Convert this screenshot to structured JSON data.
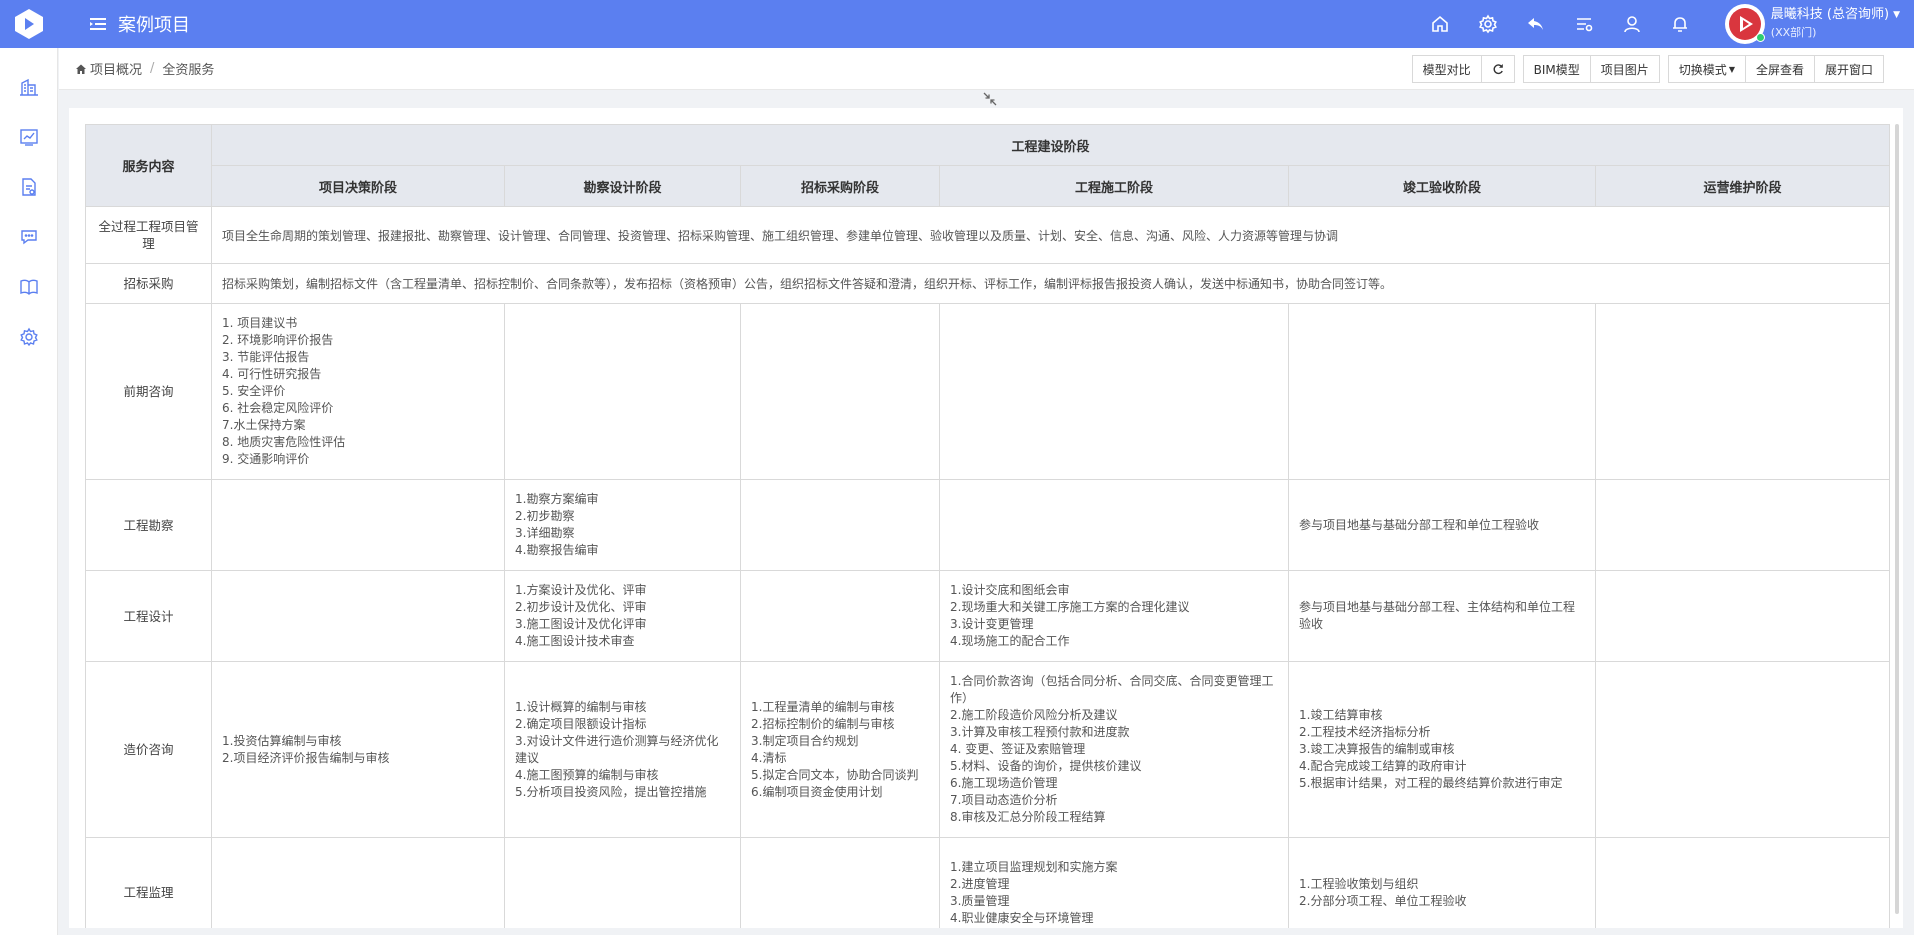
{
  "app": {
    "title": "案例项目"
  },
  "user": {
    "name": "晨曦科技 (总咨询师)",
    "dept": "(XX部门)"
  },
  "topbar_icons": [
    "home-icon",
    "settings-icon",
    "back-icon",
    "list-icon",
    "user-icon",
    "bell-icon"
  ],
  "sidebar_icons": [
    "building-icon",
    "chart-icon",
    "document-icon",
    "chat-icon",
    "book-icon",
    "gear-icon"
  ],
  "breadcrumb": {
    "home": "项目概况",
    "current": "全资服务"
  },
  "toolbar": {
    "compare": "模型对比",
    "bim": "BIM模型",
    "images": "项目图片",
    "switch_mode": "切换模式",
    "fullscreen": "全屏查看",
    "expand_window": "展开窗口"
  },
  "table": {
    "corner_header": "服务内容",
    "group_header": "工程建设阶段",
    "stages": [
      "项目决策阶段",
      "勘察设计阶段",
      "招标采购阶段",
      "工程施工阶段",
      "竣工验收阶段",
      "运营维护阶段"
    ],
    "rows": [
      {
        "label": "全过程工程项目管理",
        "span_text": "项目全生命周期的策划管理、报建报批、勘察管理、设计管理、合同管理、投资管理、招标采购管理、施工组织管理、参建单位管理、验收管理以及质量、计划、安全、信息、沟通、风险、人力资源等管理与协调"
      },
      {
        "label": "招标采购",
        "span_text": "招标采购策划，编制招标文件（含工程量清单、招标控制价、合同条款等），发布招标（资格预审）公告，组织招标文件答疑和澄清，组织开标、评标工作，编制评标报告报投资人确认，发送中标通知书，协助合同签订等。"
      },
      {
        "label": "前期咨询",
        "cells": [
          [
            "1. 项目建议书",
            "2. 环境影响评价报告",
            "3. 节能评估报告",
            "4. 可行性研究报告",
            "5. 安全评价",
            "6. 社会稳定风险评价",
            "7.水土保持方案",
            "8. 地质灾害危险性评估",
            "9. 交通影响评价"
          ],
          [],
          [],
          [],
          [],
          []
        ]
      },
      {
        "label": "工程勘察",
        "cells": [
          [],
          [
            "1.勘察方案编审",
            "2.初步勘察",
            "3.详细勘察",
            "4.勘察报告编审"
          ],
          [],
          [],
          [
            "参与项目地基与基础分部工程和单位工程验收"
          ],
          []
        ]
      },
      {
        "label": "工程设计",
        "cells": [
          [],
          [
            "1.方案设计及优化、评审",
            "2.初步设计及优化、评审",
            "3.施工图设计及优化评审",
            "4.施工图设计技术审查"
          ],
          [],
          [
            "1.设计交底和图纸会审",
            "2.现场重大和关键工序施工方案的合理化建议",
            "3.设计变更管理",
            "4.现场施工的配合工作"
          ],
          [
            "参与项目地基与基础分部工程、主体结构和单位工程验收"
          ],
          []
        ]
      },
      {
        "label": "造价咨询",
        "cells": [
          [
            "1.投资估算编制与审核",
            "2.项目经济评价报告编制与审核"
          ],
          [
            "1.设计概算的编制与审核",
            "2.确定项目限额设计指标",
            "3.对设计文件进行造价测算与经济优化建议",
            "4.施工图预算的编制与审核",
            "5.分析项目投资风险，提出管控措施"
          ],
          [
            "1.工程量清单的编制与审核",
            "2.招标控制价的编制与审核",
            "3.制定项目合约规划",
            "4.清标",
            "5.拟定合同文本，协助合同谈判",
            "6.编制项目资金使用计划"
          ],
          [
            "1.合同价款咨询（包括合同分析、合同交底、合同变更管理工作）",
            "2.施工阶段造价风险分析及建议",
            "3.计算及审核工程预付款和进度款",
            "4. 变更、签证及索赔管理",
            "5.材料、设备的询价，提供核价建议",
            "6.施工现场造价管理",
            "7.项目动态造价分析",
            "8.审核及汇总分阶段工程结算"
          ],
          [
            "1.竣工结算审核",
            "2.工程技术经济指标分析",
            "3.竣工决算报告的编制或审核",
            "4.配合完成竣工结算的政府审计",
            "5.根据审计结果，对工程的最终结算价款进行审定"
          ],
          []
        ]
      },
      {
        "label": "工程监理",
        "cells": [
          [],
          [],
          [],
          [
            "1.建立项目监理规划和实施方案",
            "2.进度管理",
            "3.质量管理",
            "4.职业健康安全与环境管理"
          ],
          [
            "1.工程验收策划与组织",
            "2.分部分项工程、单位工程验收"
          ],
          []
        ]
      }
    ]
  }
}
